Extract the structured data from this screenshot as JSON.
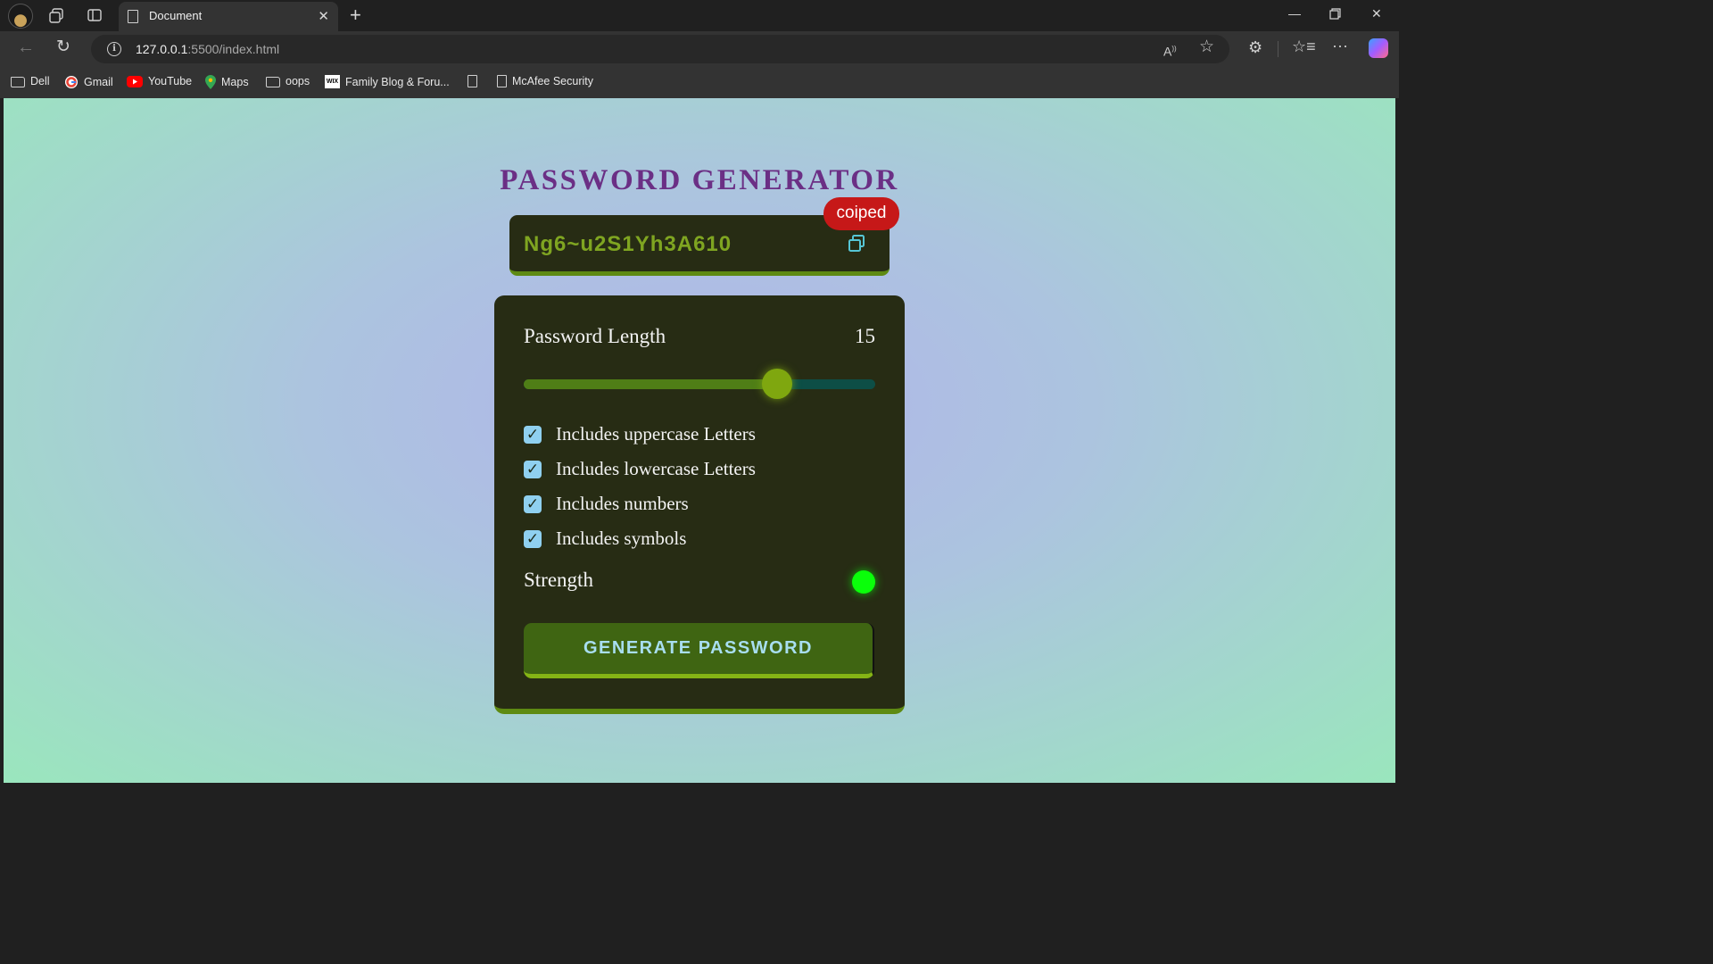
{
  "browser": {
    "tab_title": "Document",
    "url_host": "127.0.0.1",
    "url_rest": ":5500/index.html",
    "bookmarks": [
      {
        "label": "Dell",
        "icon": "folder-icon"
      },
      {
        "label": "Gmail",
        "icon": "gmail-icon"
      },
      {
        "label": "YouTube",
        "icon": "youtube-icon"
      },
      {
        "label": "Maps",
        "icon": "maps-icon"
      },
      {
        "label": "oops",
        "icon": "folder-icon"
      },
      {
        "label": "Family Blog & Foru...",
        "icon": "wix-icon"
      },
      {
        "label": "",
        "icon": "document-icon"
      },
      {
        "label": "McAfee Security",
        "icon": "document-icon"
      }
    ]
  },
  "app": {
    "title": "PASSWORD GENERATOR",
    "password": "Ng6~u2S1Yh3A610",
    "copied_text": "coiped",
    "length_label": "Password Length",
    "length_value": "15",
    "slider_fraction": 0.72,
    "options": [
      {
        "label": "Includes uppercase Letters",
        "checked": true
      },
      {
        "label": "Includes lowercase Letters",
        "checked": true
      },
      {
        "label": "Includes numbers",
        "checked": true
      },
      {
        "label": "Includes symbols",
        "checked": true
      }
    ],
    "strength_label": "Strength",
    "strength_color": "#0aff0a",
    "generate_label": "GENERATE PASSWORD"
  },
  "colors": {
    "title": "#6b2f85",
    "card": "#272c14",
    "accent": "#7fa521",
    "badge": "#c61818"
  }
}
